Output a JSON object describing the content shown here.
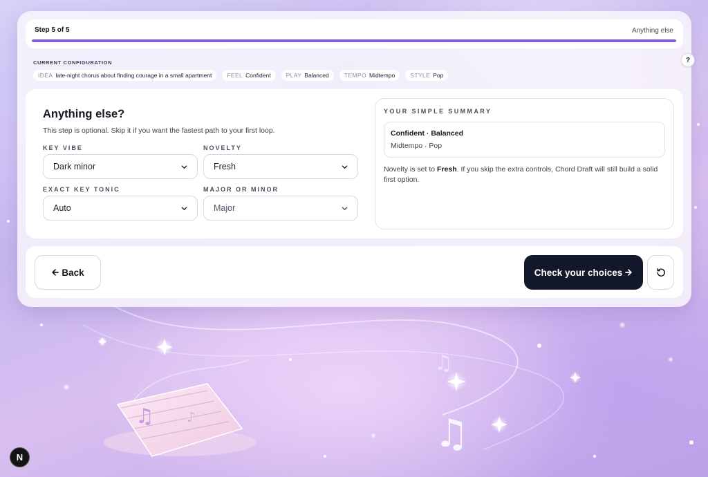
{
  "progress": {
    "step_label": "Step 5 of 5",
    "step_name": "Anything else",
    "fraction": 1.0
  },
  "config": {
    "title": "CURRENT CONFIGURATION",
    "chips": [
      {
        "key": "IDEA",
        "value": "late-night chorus about finding courage in a small apartment"
      },
      {
        "key": "FEEL",
        "value": "Confident"
      },
      {
        "key": "PLAY",
        "value": "Balanced"
      },
      {
        "key": "TEMPO",
        "value": "Midtempo"
      },
      {
        "key": "STYLE",
        "value": "Pop"
      }
    ],
    "help_label": "?"
  },
  "form": {
    "title": "Anything else?",
    "subtitle": "This step is optional. Skip it if you want the fastest path to your first loop.",
    "key_vibe": {
      "label": "KEY VIBE",
      "value": "Dark minor"
    },
    "novelty": {
      "label": "NOVELTY",
      "value": "Fresh"
    },
    "exact_key": {
      "label": "EXACT KEY TONIC",
      "value": "Auto"
    },
    "major_minor": {
      "label": "MAJOR OR MINOR",
      "value": "Major"
    }
  },
  "summary": {
    "title": "YOUR SIMPLE SUMMARY",
    "line1": "Confident · Balanced",
    "line2": "Midtempo · Pop",
    "text_before": "Novelty is set to ",
    "text_bold": "Fresh",
    "text_after": ". If you skip the extra controls, Chord Draft will still build a solid first option."
  },
  "actions": {
    "back_label": "Back",
    "check_label": "Check your choices"
  },
  "badge": {
    "label": "N"
  },
  "colors": {
    "accent": "#8a5bdf",
    "primary_button": "#121729"
  }
}
